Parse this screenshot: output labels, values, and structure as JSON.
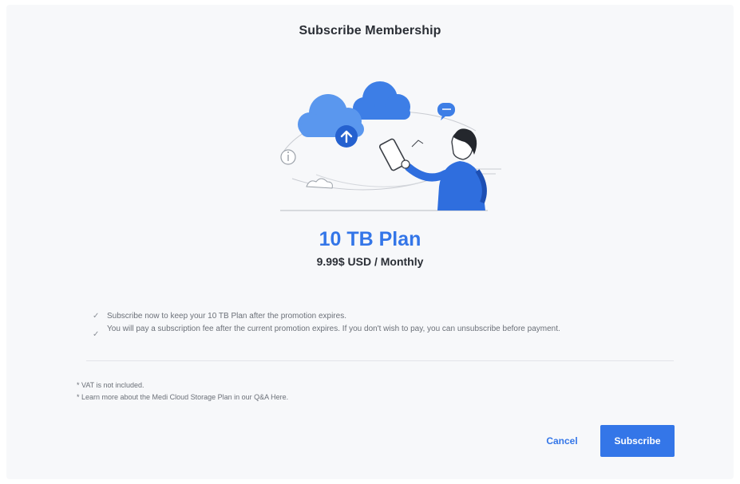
{
  "dialog": {
    "title": "Subscribe Membership",
    "plan_name": "10 TB Plan",
    "plan_price": "9.99$ USD / Monthly",
    "notes": [
      "Subscribe now to keep your 10 TB Plan after the promotion expires.",
      "You will pay a subscription fee after the current promotion expires. If you don't wish to pay, you can unsubscribe before payment."
    ],
    "footnotes": [
      "* VAT is not included.",
      "* Learn more about the Medi Cloud Storage Plan in our Q&A Here."
    ],
    "cancel_label": "Cancel",
    "subscribe_label": "Subscribe"
  },
  "colors": {
    "accent": "#3476e8",
    "background": "#f7f8fa",
    "text": "#2b2f36"
  },
  "icons": {
    "check": "check-icon",
    "upload": "upload-arrow-icon",
    "chat": "chat-bubble-icon",
    "info": "info-icon"
  }
}
